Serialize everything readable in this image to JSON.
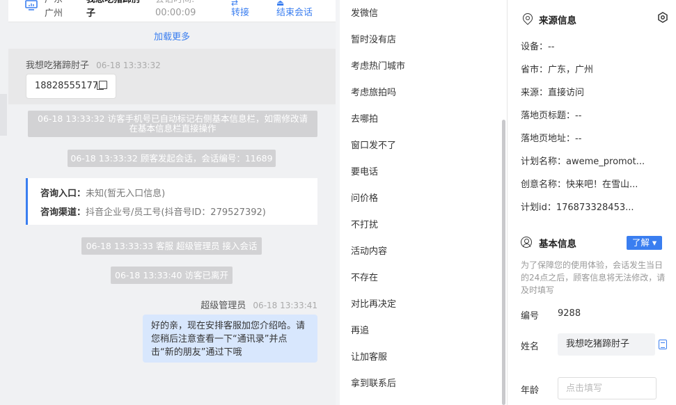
{
  "header": {
    "city": "广东 广州",
    "visitor_name": "我想吃猪蹄肘子",
    "duration_label": "会话时间:",
    "duration": "00:00:09",
    "transfer_label": "转接",
    "end_label": "结束会话"
  },
  "chat": {
    "load_more": "加载更多",
    "visitor_msg": {
      "sender": "我想吃猪蹄肘子",
      "time": "06-18 13:33:32",
      "text": "18828555177"
    },
    "sys_note_1_line1": "06-18 13:33:32 访客手机号已自动标记右侧基本信息栏，如需修改请",
    "sys_note_1_line2": "在基本信息栏直接操作",
    "sys_note_2": "06-18 13:33:32 顾客发起会话，会话编号：11689",
    "entry_label": "咨询入口：",
    "entry_value": "未知(暂无入口信息)",
    "channel_label": "咨询渠道：",
    "channel_value": "抖音企业号/员工号(抖音号ID：279527392)",
    "sys_note_3": "06-18 13:33:33 客服 超级管理员 接入会话",
    "sys_note_4": "06-18 13:33:40 访客已离开",
    "agent_msg": {
      "sender": "超级管理员",
      "time": "06-18 13:33:41",
      "text": "好的亲，现在安排客服加您介绍哈。请您稍后注意查看一下“通讯录”并点击“新的朋友”通过下哦"
    }
  },
  "quick_replies": [
    "发微信",
    "暂时没有店",
    "考虑热门城市",
    "考虑旅拍吗",
    "去哪拍",
    "窗口发不了",
    "要电话",
    "问价格",
    "不打扰",
    "活动内容",
    "不存在",
    "对比再决定",
    "再追",
    "让加客服",
    "拿到联系后"
  ],
  "source_info": {
    "title": "来源信息",
    "device": "设备：--",
    "province": "省市：广东，广州",
    "source": "来源：直接访问",
    "landing_title": "落地页标题：--",
    "landing_url": "落地页地址：--",
    "plan_name": "计划名称：aweme_promot...",
    "creative_name": "创意名称：快来吧！在雪山...",
    "plan_id": "计划id：176873328453..."
  },
  "basic_info": {
    "title": "基本信息",
    "learn_btn": "了解 ▾",
    "note": "为了保障您的使用体验，会话发生当日的24点之后，顾客信息将无法修改，请及时填写",
    "id_label": "编号",
    "id_value": "9288",
    "name_label": "姓名",
    "name_value": "我想吃猪蹄肘子",
    "age_label": "年龄",
    "age_placeholder": "点击填写"
  },
  "colors": {
    "accent": "#3a7ef0",
    "agent_bubble": "#d8e7fd",
    "system_note": "#d2d2d4"
  }
}
